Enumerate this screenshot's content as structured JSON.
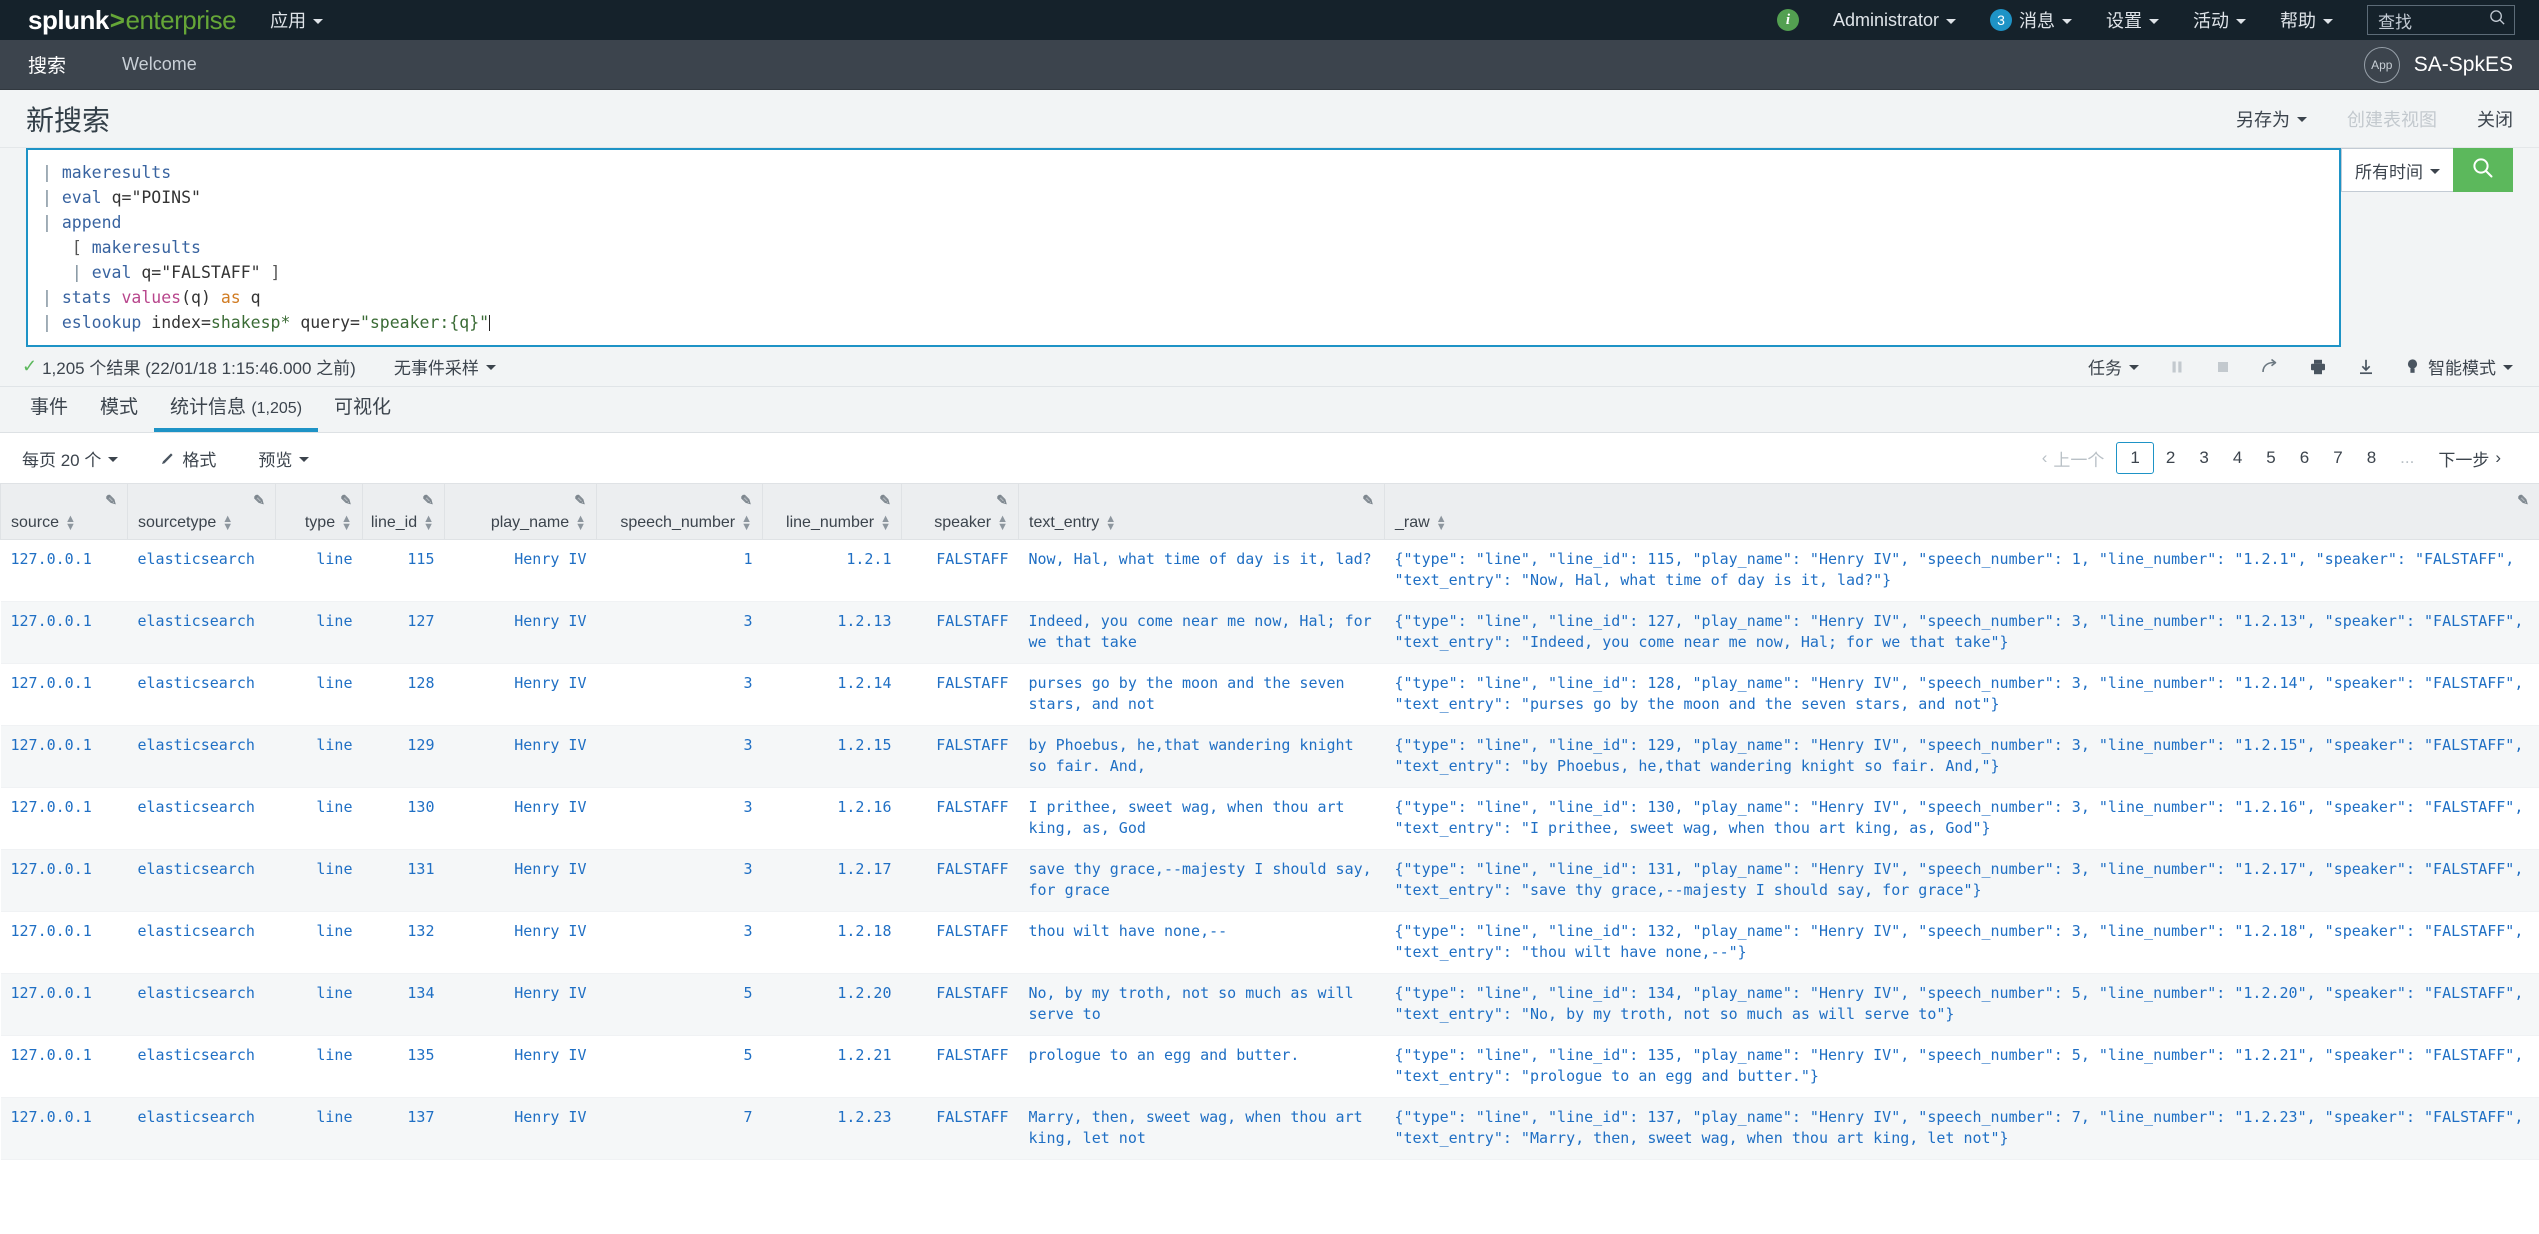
{
  "topnav": {
    "logo": {
      "splunk": "splunk",
      "gt": ">",
      "enterprise": "enterprise"
    },
    "apps_label": "应用",
    "info_icon": "i",
    "user": "Administrator",
    "messages": {
      "count": "3",
      "label": "消息"
    },
    "settings": "设置",
    "activity": "活动",
    "help": "帮助",
    "find_placeholder": "查找"
  },
  "appbar": {
    "tab_search": "搜索",
    "tab_welcome": "Welcome",
    "app_badge": "App",
    "app_name": "SA-SpkES"
  },
  "page": {
    "title": "新搜索",
    "save_as": "另存为",
    "create_table_view": "创建表视图",
    "close": "关闭"
  },
  "search": {
    "query_lines": [
      "| makeresults",
      "| eval q=\"POINS\"",
      "| append",
      "    [ makeresults",
      "    | eval q=\"FALSTAFF\" ]",
      "| stats values(q) as q",
      "| eslookup index=shakesp* query=\"speaker:{q}\""
    ],
    "time_range": "所有时间",
    "search_icon": "search-icon"
  },
  "results": {
    "check": "✓",
    "count_text": "1,205 个结果 (22/01/18 1:15:46.000 之前)",
    "sampling": "无事件采样",
    "job": "任务",
    "pause_icon": "pause-icon",
    "stop_icon": "stop-icon",
    "share_icon": "share-icon",
    "print_icon": "print-icon",
    "export_icon": "download-icon",
    "mode_icon": "lightbulb-icon",
    "mode": "智能模式"
  },
  "tabs": [
    {
      "label": "事件",
      "count": "",
      "active": false
    },
    {
      "label": "模式",
      "count": "",
      "active": false
    },
    {
      "label": "统计信息",
      "count": "(1,205)",
      "active": true
    },
    {
      "label": "可视化",
      "count": "",
      "active": false
    }
  ],
  "controls": {
    "per_page": "每页 20 个",
    "format": "格式",
    "preview": "预览",
    "format_icon": "brush-icon"
  },
  "pagination": {
    "prev": "上一个",
    "next": "下一步",
    "pages": [
      "1",
      "2",
      "3",
      "4",
      "5",
      "6",
      "7",
      "8"
    ],
    "ellipsis": "...",
    "current": "1"
  },
  "table": {
    "columns": [
      {
        "key": "source",
        "label": "source",
        "align": "left"
      },
      {
        "key": "sourcetype",
        "label": "sourcetype",
        "align": "left"
      },
      {
        "key": "type",
        "label": "type",
        "align": "right"
      },
      {
        "key": "line_id",
        "label": "line_id",
        "align": "right"
      },
      {
        "key": "play_name",
        "label": "play_name",
        "align": "right"
      },
      {
        "key": "speech_number",
        "label": "speech_number",
        "align": "right"
      },
      {
        "key": "line_number",
        "label": "line_number",
        "align": "right"
      },
      {
        "key": "speaker",
        "label": "speaker",
        "align": "right"
      },
      {
        "key": "text_entry",
        "label": "text_entry",
        "align": "left"
      },
      {
        "key": "_raw",
        "label": "_raw",
        "align": "left"
      }
    ],
    "rows": [
      {
        "source": "127.0.0.1",
        "sourcetype": "elasticsearch",
        "type": "line",
        "line_id": "115",
        "play_name": "Henry IV",
        "speech_number": "1",
        "line_number": "1.2.1",
        "speaker": "FALSTAFF",
        "text_entry": "Now, Hal, what time of day is it, lad?",
        "_raw": "{\"type\": \"line\", \"line_id\": 115, \"play_name\": \"Henry IV\", \"speech_number\": 1, \"line_number\": \"1.2.1\", \"speaker\": \"FALSTAFF\", \"text_entry\": \"Now, Hal, what time of day is it, lad?\"}"
      },
      {
        "source": "127.0.0.1",
        "sourcetype": "elasticsearch",
        "type": "line",
        "line_id": "127",
        "play_name": "Henry IV",
        "speech_number": "3",
        "line_number": "1.2.13",
        "speaker": "FALSTAFF",
        "text_entry": "Indeed, you come near me now, Hal; for we that take",
        "_raw": "{\"type\": \"line\", \"line_id\": 127, \"play_name\": \"Henry IV\", \"speech_number\": 3, \"line_number\": \"1.2.13\", \"speaker\": \"FALSTAFF\", \"text_entry\": \"Indeed, you come near me now, Hal; for we that take\"}"
      },
      {
        "source": "127.0.0.1",
        "sourcetype": "elasticsearch",
        "type": "line",
        "line_id": "128",
        "play_name": "Henry IV",
        "speech_number": "3",
        "line_number": "1.2.14",
        "speaker": "FALSTAFF",
        "text_entry": "purses go by the moon and the seven stars, and not",
        "_raw": "{\"type\": \"line\", \"line_id\": 128, \"play_name\": \"Henry IV\", \"speech_number\": 3, \"line_number\": \"1.2.14\", \"speaker\": \"FALSTAFF\", \"text_entry\": \"purses go by the moon and the seven stars, and not\"}"
      },
      {
        "source": "127.0.0.1",
        "sourcetype": "elasticsearch",
        "type": "line",
        "line_id": "129",
        "play_name": "Henry IV",
        "speech_number": "3",
        "line_number": "1.2.15",
        "speaker": "FALSTAFF",
        "text_entry": "by Phoebus, he,that wandering knight so fair. And,",
        "_raw": "{\"type\": \"line\", \"line_id\": 129, \"play_name\": \"Henry IV\", \"speech_number\": 3, \"line_number\": \"1.2.15\", \"speaker\": \"FALSTAFF\", \"text_entry\": \"by Phoebus, he,that wandering knight so fair. And,\"}"
      },
      {
        "source": "127.0.0.1",
        "sourcetype": "elasticsearch",
        "type": "line",
        "line_id": "130",
        "play_name": "Henry IV",
        "speech_number": "3",
        "line_number": "1.2.16",
        "speaker": "FALSTAFF",
        "text_entry": "I prithee, sweet wag, when thou art king, as, God",
        "_raw": "{\"type\": \"line\", \"line_id\": 130, \"play_name\": \"Henry IV\", \"speech_number\": 3, \"line_number\": \"1.2.16\", \"speaker\": \"FALSTAFF\", \"text_entry\": \"I prithee, sweet wag, when thou art king, as, God\"}"
      },
      {
        "source": "127.0.0.1",
        "sourcetype": "elasticsearch",
        "type": "line",
        "line_id": "131",
        "play_name": "Henry IV",
        "speech_number": "3",
        "line_number": "1.2.17",
        "speaker": "FALSTAFF",
        "text_entry": "save thy grace,--majesty I should say, for grace",
        "_raw": "{\"type\": \"line\", \"line_id\": 131, \"play_name\": \"Henry IV\", \"speech_number\": 3, \"line_number\": \"1.2.17\", \"speaker\": \"FALSTAFF\", \"text_entry\": \"save thy grace,--majesty I should say, for grace\"}"
      },
      {
        "source": "127.0.0.1",
        "sourcetype": "elasticsearch",
        "type": "line",
        "line_id": "132",
        "play_name": "Henry IV",
        "speech_number": "3",
        "line_number": "1.2.18",
        "speaker": "FALSTAFF",
        "text_entry": "thou wilt have none,--",
        "_raw": "{\"type\": \"line\", \"line_id\": 132, \"play_name\": \"Henry IV\", \"speech_number\": 3, \"line_number\": \"1.2.18\", \"speaker\": \"FALSTAFF\", \"text_entry\": \"thou wilt have none,--\"}"
      },
      {
        "source": "127.0.0.1",
        "sourcetype": "elasticsearch",
        "type": "line",
        "line_id": "134",
        "play_name": "Henry IV",
        "speech_number": "5",
        "line_number": "1.2.20",
        "speaker": "FALSTAFF",
        "text_entry": "No, by my troth, not so much as will serve to",
        "_raw": "{\"type\": \"line\", \"line_id\": 134, \"play_name\": \"Henry IV\", \"speech_number\": 5, \"line_number\": \"1.2.20\", \"speaker\": \"FALSTAFF\", \"text_entry\": \"No, by my troth, not so much as will serve to\"}"
      },
      {
        "source": "127.0.0.1",
        "sourcetype": "elasticsearch",
        "type": "line",
        "line_id": "135",
        "play_name": "Henry IV",
        "speech_number": "5",
        "line_number": "1.2.21",
        "speaker": "FALSTAFF",
        "text_entry": "prologue to an egg and butter.",
        "_raw": "{\"type\": \"line\", \"line_id\": 135, \"play_name\": \"Henry IV\", \"speech_number\": 5, \"line_number\": \"1.2.21\", \"speaker\": \"FALSTAFF\", \"text_entry\": \"prologue to an egg and butter.\"}"
      },
      {
        "source": "127.0.0.1",
        "sourcetype": "elasticsearch",
        "type": "line",
        "line_id": "137",
        "play_name": "Henry IV",
        "speech_number": "7",
        "line_number": "1.2.23",
        "speaker": "FALSTAFF",
        "text_entry": "Marry, then, sweet wag, when thou art king, let not",
        "_raw": "{\"type\": \"line\", \"line_id\": 137, \"play_name\": \"Henry IV\", \"speech_number\": 7, \"line_number\": \"1.2.23\", \"speaker\": \"FALSTAFF\", \"text_entry\": \"Marry, then, sweet wag, when thou art king, let not\"}"
      }
    ]
  },
  "colors": {
    "nav_bg": "#15222b",
    "appbar_bg": "#3c444d",
    "accent_green": "#65a637",
    "search_green": "#5cb85c",
    "accent_blue": "#1e93c6",
    "link_blue": "#1f6fc4"
  }
}
